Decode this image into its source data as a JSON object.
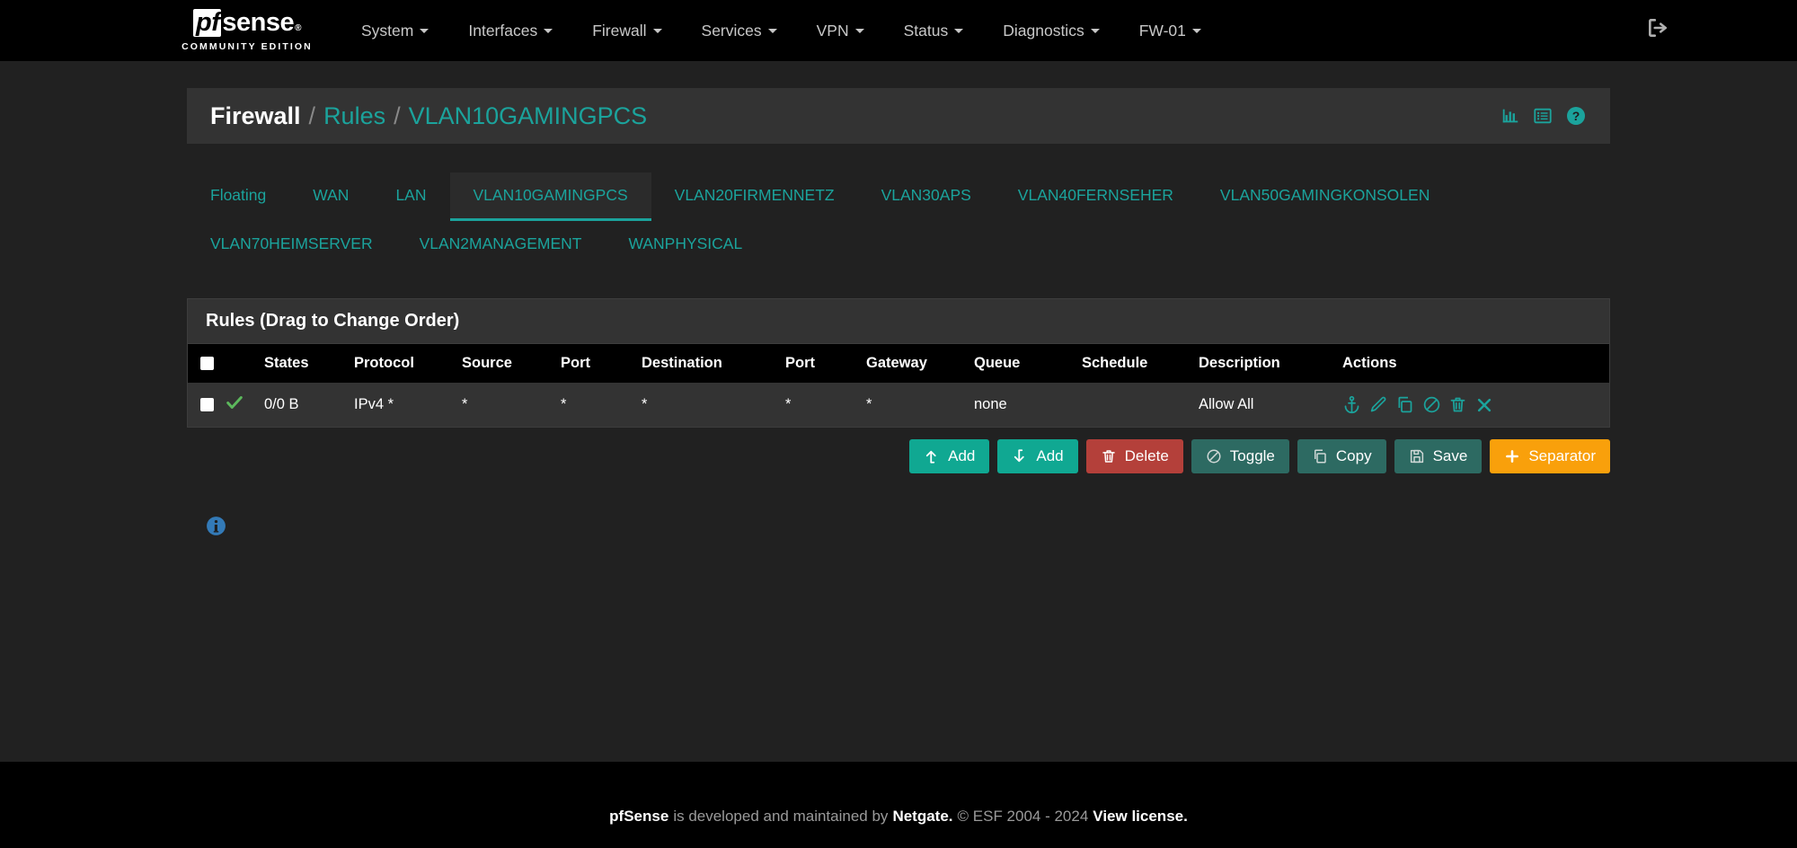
{
  "navbar": {
    "brand": {
      "pf": "pf",
      "sense": "sense",
      "reg": "®",
      "subtitle": "COMMUNITY EDITION"
    },
    "items": [
      {
        "label": "System",
        "caret": true
      },
      {
        "label": "Interfaces",
        "caret": true
      },
      {
        "label": "Firewall",
        "caret": true
      },
      {
        "label": "Services",
        "caret": true
      },
      {
        "label": "VPN",
        "caret": true
      },
      {
        "label": "Status",
        "caret": true
      },
      {
        "label": "Diagnostics",
        "caret": true
      },
      {
        "label": "FW-01",
        "caret": true
      }
    ],
    "logout_icon": "sign-out-icon"
  },
  "breadcrumb": {
    "root": "Firewall",
    "sep": "/",
    "link": "Rules",
    "current": "VLAN10GAMINGPCS",
    "icons": [
      "chart-icon",
      "list-icon",
      "help-icon"
    ]
  },
  "tabs": [
    {
      "label": "Floating",
      "active": false
    },
    {
      "label": "WAN",
      "active": false
    },
    {
      "label": "LAN",
      "active": false
    },
    {
      "label": "VLAN10GAMINGPCS",
      "active": true
    },
    {
      "label": "VLAN20FIRMENNETZ",
      "active": false
    },
    {
      "label": "VLAN30APS",
      "active": false
    },
    {
      "label": "VLAN40FERNSEHER",
      "active": false
    },
    {
      "label": "VLAN50GAMINGKONSOLEN",
      "active": false
    },
    {
      "label": "VLAN70HEIMSERVER",
      "active": false
    },
    {
      "label": "VLAN2MANAGEMENT",
      "active": false
    },
    {
      "label": "WANPHYSICAL",
      "active": false
    }
  ],
  "rules_panel": {
    "title": "Rules (Drag to Change Order)",
    "columns": [
      "",
      "",
      "States",
      "Protocol",
      "Source",
      "Port",
      "Destination",
      "Port",
      "Gateway",
      "Queue",
      "Schedule",
      "Description",
      "Actions"
    ],
    "rows": [
      {
        "status_icon": "check-icon",
        "states": "0/0 B",
        "protocol": "IPv4 *",
        "source": "*",
        "port": "*",
        "destination": "*",
        "dest_port": "*",
        "gateway": "*",
        "queue": "none",
        "schedule": "",
        "description": "Allow All",
        "actions": [
          "anchor-icon",
          "pencil-icon",
          "copy-icon",
          "ban-icon",
          "trash-icon",
          "close-icon"
        ]
      }
    ]
  },
  "buttons": [
    {
      "label": "Add",
      "icon": "arrow-up-icon",
      "style": "success"
    },
    {
      "label": "Add",
      "icon": "arrow-down-icon",
      "style": "success"
    },
    {
      "label": "Delete",
      "icon": "trash-icon",
      "style": "danger"
    },
    {
      "label": "Toggle",
      "icon": "ban-icon",
      "style": "default"
    },
    {
      "label": "Copy",
      "icon": "copy-icon",
      "style": "default"
    },
    {
      "label": "Save",
      "icon": "save-icon",
      "style": "default"
    },
    {
      "label": "Separator",
      "icon": "plus-icon",
      "style": "warning"
    }
  ],
  "info": {
    "icon": "info-circle-icon"
  },
  "footer": {
    "brand": "pfSense",
    "text1": "is developed and maintained by",
    "vendor": "Netgate.",
    "copyright": "© ESF 2004 - 2024",
    "license": "View license."
  },
  "colors": {
    "accent": "#1ba39c",
    "success": "#10a892",
    "danger": "#b4403a",
    "warning": "#f9a00b",
    "default": "#2d6a62",
    "info": "#337ab7",
    "check": "#5cb85c"
  }
}
